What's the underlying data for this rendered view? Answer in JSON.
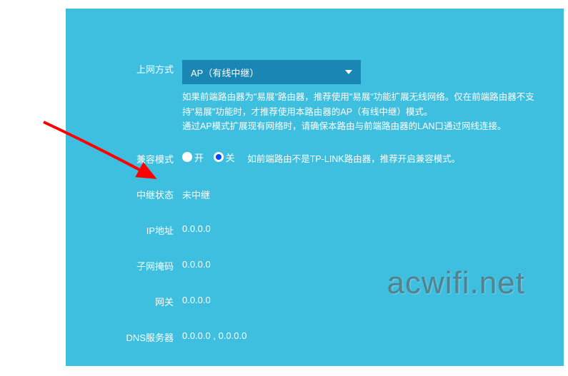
{
  "form": {
    "connection_mode": {
      "label": "上网方式",
      "selected": "AP（有线中继）"
    },
    "description": "如果前端路由器为\"易展\"路由器，推荐使用\"易展\"功能扩展无线网络。仅在前端路由器不支持\"易展\"功能时，才推荐使用本路由器的AP（有线中继）模式。\n通过AP模式扩展现有网络时，请确保本路由与前端路由器的LAN口通过网线连接。",
    "compat_mode": {
      "label": "兼容模式",
      "option_on": "开",
      "option_off": "关",
      "selected": "off",
      "hint": "如前端路由不是TP-LINK路由器，推荐开启兼容模式。"
    },
    "relay_status": {
      "label": "中继状态",
      "value": "未中继"
    },
    "ip_address": {
      "label": "IP地址",
      "value": "0.0.0.0"
    },
    "subnet_mask": {
      "label": "子网掩码",
      "value": "0.0.0.0"
    },
    "gateway": {
      "label": "网关",
      "value": "0.0.0.0"
    },
    "dns_server": {
      "label": "DNS服务器",
      "value": "0.0.0.0 , 0.0.0.0"
    }
  },
  "watermark": "acwifi.net"
}
